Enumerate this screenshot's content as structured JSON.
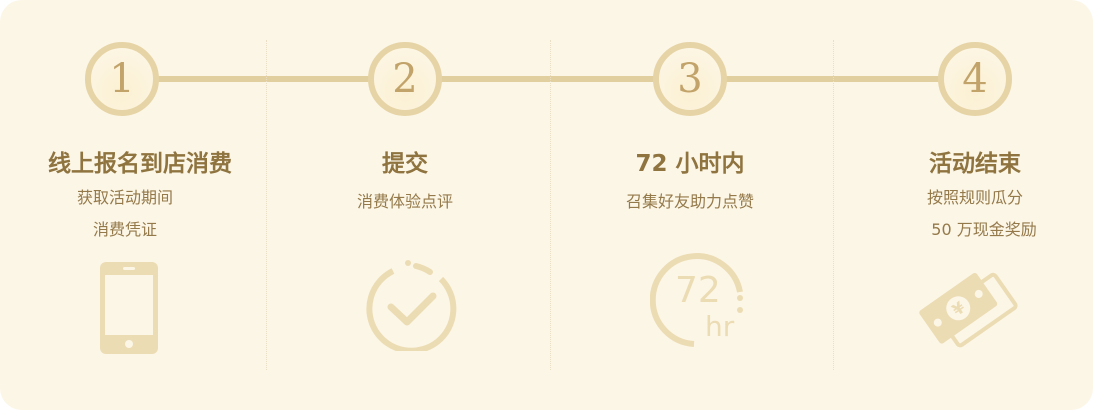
{
  "steps": [
    {
      "number": "1",
      "title": "线上报名到店消费",
      "lines": [
        "获取活动期间",
        "消费凭证"
      ],
      "icon": "phone-icon"
    },
    {
      "number": "2",
      "title": "提交",
      "lines": [
        "消费体验点评"
      ],
      "icon": "check-circle-icon"
    },
    {
      "number": "3",
      "title": "72 小时内",
      "lines": [
        "召集好友助力点赞"
      ],
      "icon": "72hr-timer-icon",
      "icon_text": [
        "72",
        "hr"
      ]
    },
    {
      "number": "4",
      "title": "活动结束",
      "lines": [
        "按照规则瓜分",
        "50 万现金奖励"
      ],
      "icon": "cash-icon"
    }
  ],
  "colors": {
    "background": "#fcf6e6",
    "accent": "#8f7440",
    "icon": "#ecdcb4",
    "line": "#e2cf9f"
  }
}
